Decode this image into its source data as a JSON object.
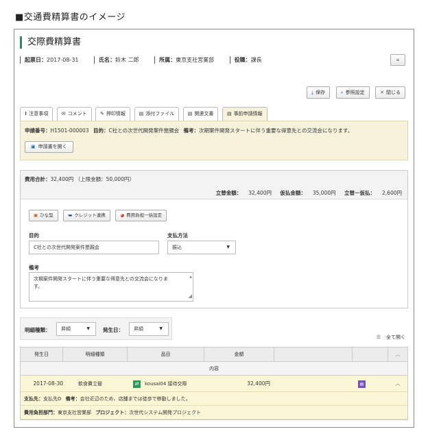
{
  "caption": "■交通費精算書のイメージ",
  "title": "交際費精算書",
  "info": {
    "start_label": "起票日：",
    "start_value": "2017-08-31",
    "name_label": "氏名：",
    "name_value": "鈴木 二郎",
    "dept_label": "所属：",
    "dept_value": "東京支社営業部",
    "role_label": "役職：",
    "role_value": "課長"
  },
  "menu_label": "≡",
  "actions": {
    "save": "保存",
    "settings": "参照設定",
    "close": "閉じる"
  },
  "tabs": [
    {
      "icon": "!",
      "label": "注意事項"
    },
    {
      "icon": "✉",
      "label": "コメント"
    },
    {
      "icon": "✎",
      "label": "押印情報"
    },
    {
      "icon": "▤",
      "label": "添付ファイル"
    },
    {
      "icon": "▤",
      "label": "関連文書"
    },
    {
      "icon": "▤",
      "label": "事前申請情報"
    }
  ],
  "application": {
    "no_label": "申請番号：",
    "no_value": "H1501-000003",
    "purpose_label": "目的：",
    "purpose_value": "C社との次世代開発案件懇親会",
    "remarks_label": "備考：",
    "remarks_value": "次期案件開発スタートに伴う重要な得意先との交流会になります。",
    "open_button": "申請書を開く"
  },
  "cost": {
    "total_label": "費用合計：",
    "total_value": "32,400円",
    "limit_text": "（上限金額：50,000円）",
    "advance_label": "立替金額：",
    "advance_value": "32,400円",
    "prepaid_label": "仮払金額：",
    "prepaid_value": "35,000円",
    "diff_label": "立替－仮払：",
    "diff_value": "2,600円"
  },
  "tools": {
    "template": "ひな型",
    "credit": "クレジット連携",
    "bulk": "費用負担一括設定"
  },
  "form": {
    "purpose_label": "目的",
    "purpose_value": "C社との次世代開発案件懇親会",
    "payment_label": "支払方法",
    "payment_value": "振込",
    "remarks_label": "備考",
    "remarks_line1": "次期案件開発スタートに伴う重要な得意先との交流会になりま",
    "remarks_line2": "す。"
  },
  "filter": {
    "type_label": "明細種類：",
    "type_value": "昇順",
    "date_label": "発生日：",
    "date_value": "昇順"
  },
  "all_open": "全て開く",
  "table": {
    "headers": [
      "発生日",
      "明細種類",
      "品目",
      "金額",
      "",
      "",
      ""
    ],
    "content_header": "内容",
    "row": {
      "date": "2017-08-30",
      "type": "飲食費立替",
      "item": "kousai04 接待交際",
      "amount": "32,400円"
    },
    "sub1_label1": "支払先：",
    "sub1_value1": "支払先D",
    "sub1_label2": "備考：",
    "sub1_value2": "会社近辺のため、店舗までは徒歩で移動しました。",
    "sub2_label1": "費用負担部門：",
    "sub2_value1": "東京支社営業部",
    "sub2_label2": "プロジェクト：",
    "sub2_value2": "次世代システム開発プロジェクト"
  }
}
